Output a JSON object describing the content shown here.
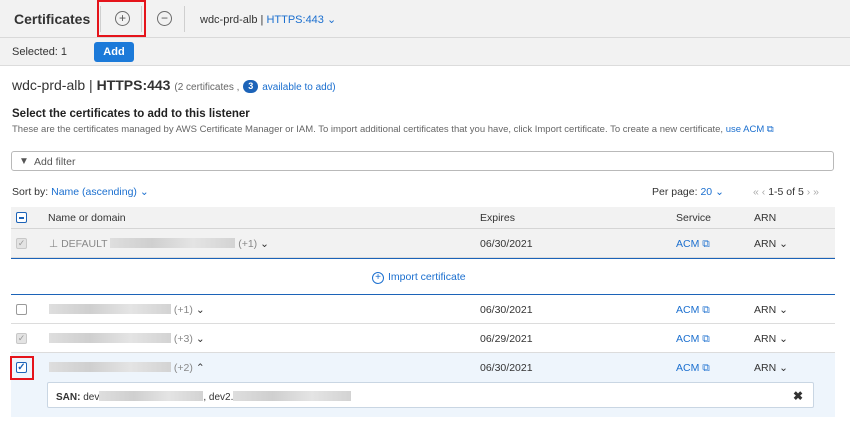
{
  "header": {
    "title": "Certificates",
    "add_icon": "plus-circle-icon",
    "remove_icon": "minus-circle-icon",
    "lb_name": "wdc-prd-alb",
    "separator": "|",
    "listener": "HTTPS:443"
  },
  "actionbar": {
    "selected_label": "Selected: 1",
    "add_label": "Add"
  },
  "heading": {
    "lb_name": "wdc-prd-alb",
    "separator": "|",
    "listener": "HTTPS:443",
    "count_text": "(2 certificates ,",
    "available_count": "3",
    "available_text": "available to add)"
  },
  "section": {
    "title": "Select the certificates to add to this listener",
    "description": "These are the certificates managed by AWS Certificate Manager or IAM. To import additional certificates that you have, click Import certificate. To create a new certificate,",
    "acm_link": "use ACM"
  },
  "filter": {
    "placeholder": "Add filter"
  },
  "controls": {
    "sort_label": "Sort by:",
    "sort_value": "Name (ascending)",
    "per_page_label": "Per page:",
    "per_page_value": "20",
    "range": "1-5 of 5"
  },
  "table": {
    "columns": [
      "Name or domain",
      "Expires",
      "Service",
      "ARN"
    ],
    "default_row": {
      "prefix": "DEFAULT",
      "extra": "(+1)",
      "expires": "06/30/2021",
      "service": "ACM",
      "arn": "ARN"
    },
    "import_label": "Import certificate",
    "rows": [
      {
        "extra": "(+1)",
        "expires": "06/30/2021",
        "service": "ACM",
        "arn": "ARN"
      },
      {
        "extra": "(+3)",
        "expires": "06/29/2021",
        "service": "ACM",
        "arn": "ARN"
      },
      {
        "extra": "(+2)",
        "expires": "06/30/2021",
        "service": "ACM",
        "arn": "ARN"
      }
    ],
    "san": {
      "label": "SAN:",
      "first": "dev",
      "second": ", dev2."
    }
  },
  "colors": {
    "accent": "#1c7ad9",
    "link": "#1b6fcf",
    "highlight": "#e5141b"
  }
}
